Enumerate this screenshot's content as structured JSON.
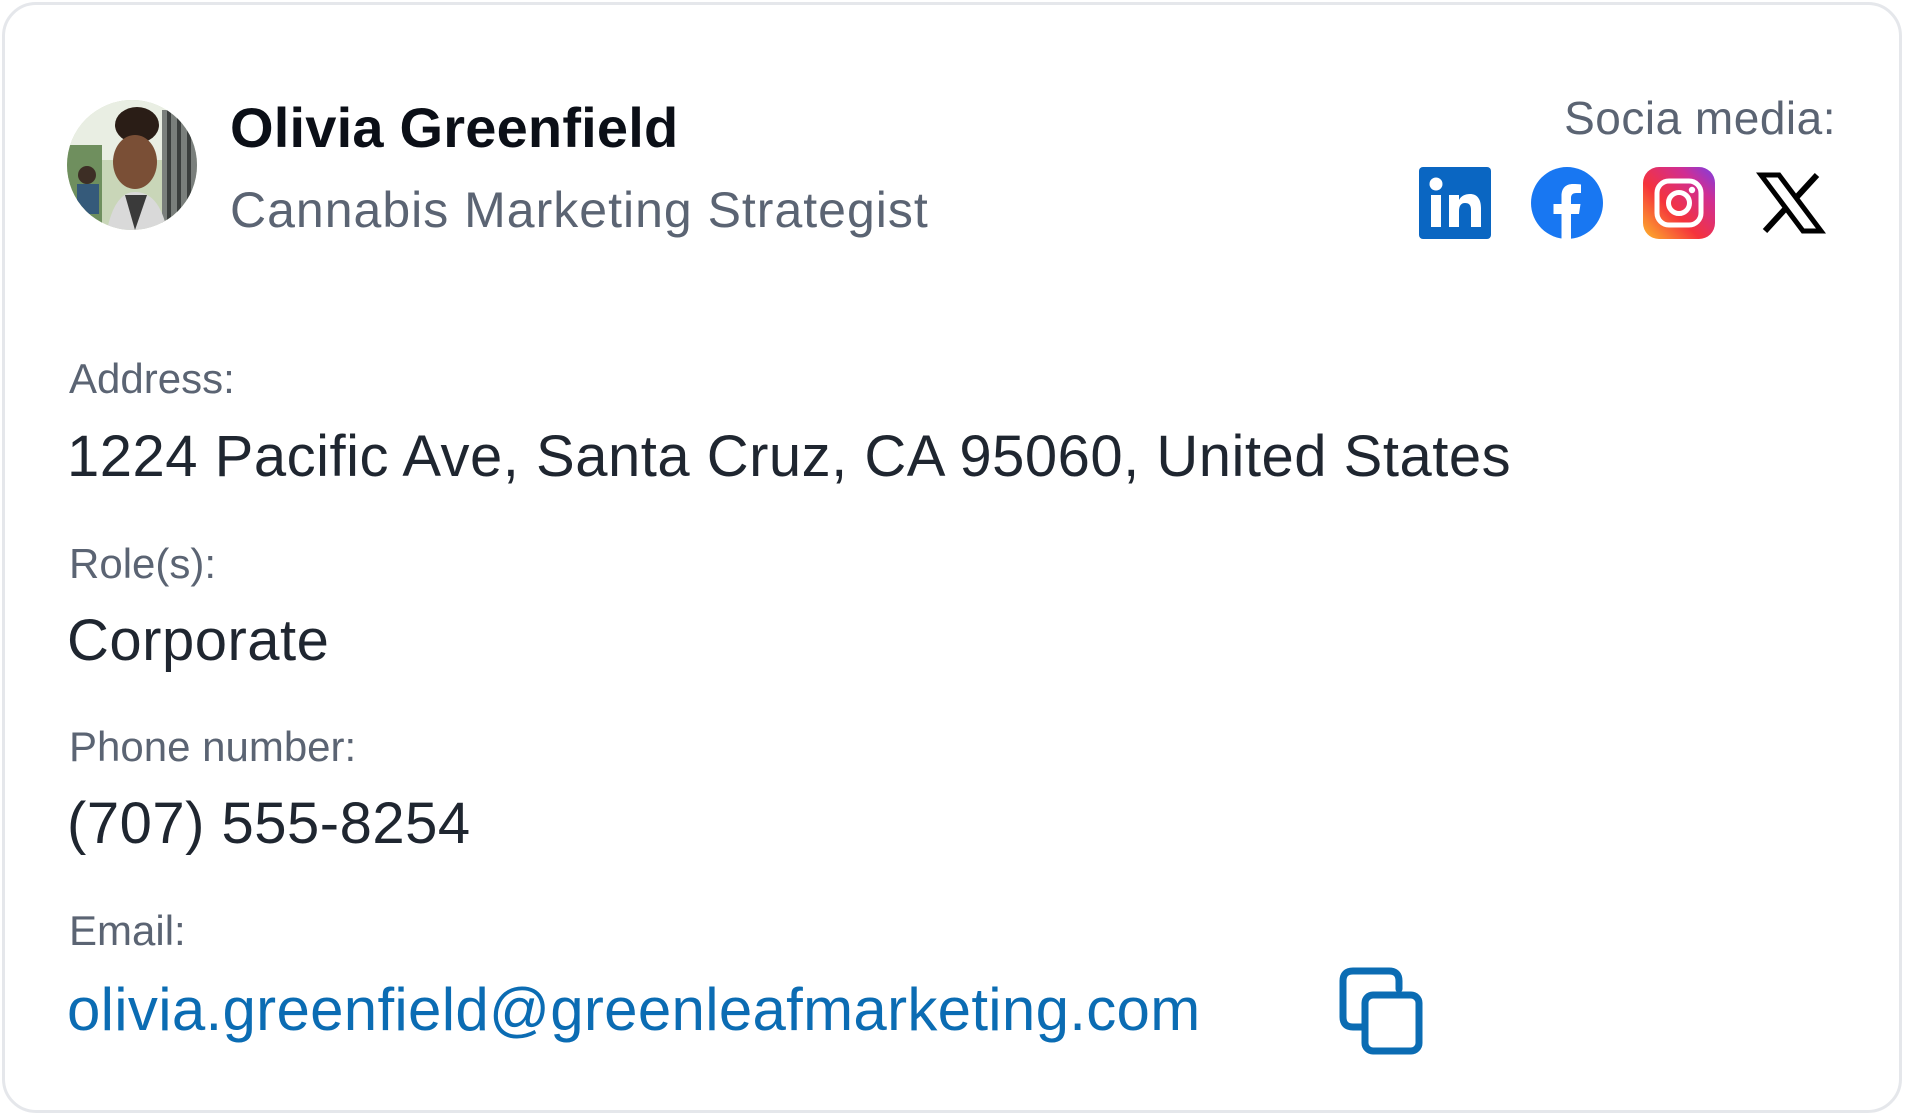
{
  "profile": {
    "name": "Olivia Greenfield",
    "title": "Cannabis Marketing Strategist"
  },
  "social": {
    "label": "Socia media:",
    "icons": [
      {
        "name": "linkedin-icon",
        "color": "#0a66c2"
      },
      {
        "name": "facebook-icon",
        "color": "#1877f2"
      },
      {
        "name": "instagram-icon",
        "color": "#e1306c"
      },
      {
        "name": "x-icon",
        "color": "#000000"
      }
    ]
  },
  "details": {
    "address_label": "Address:",
    "address": "1224 Pacific Ave, Santa Cruz, CA 95060, United States",
    "role_label": "Role(s):",
    "role": "Corporate",
    "phone_label": "Phone number:",
    "phone": "(707) 555-8254",
    "email_label": "Email:",
    "email": "olivia.greenfield@greenleafmarketing.com"
  },
  "colors": {
    "link": "#0b6cb3",
    "muted": "#5b6473",
    "text": "#1f2630",
    "border": "#e5e7eb"
  }
}
